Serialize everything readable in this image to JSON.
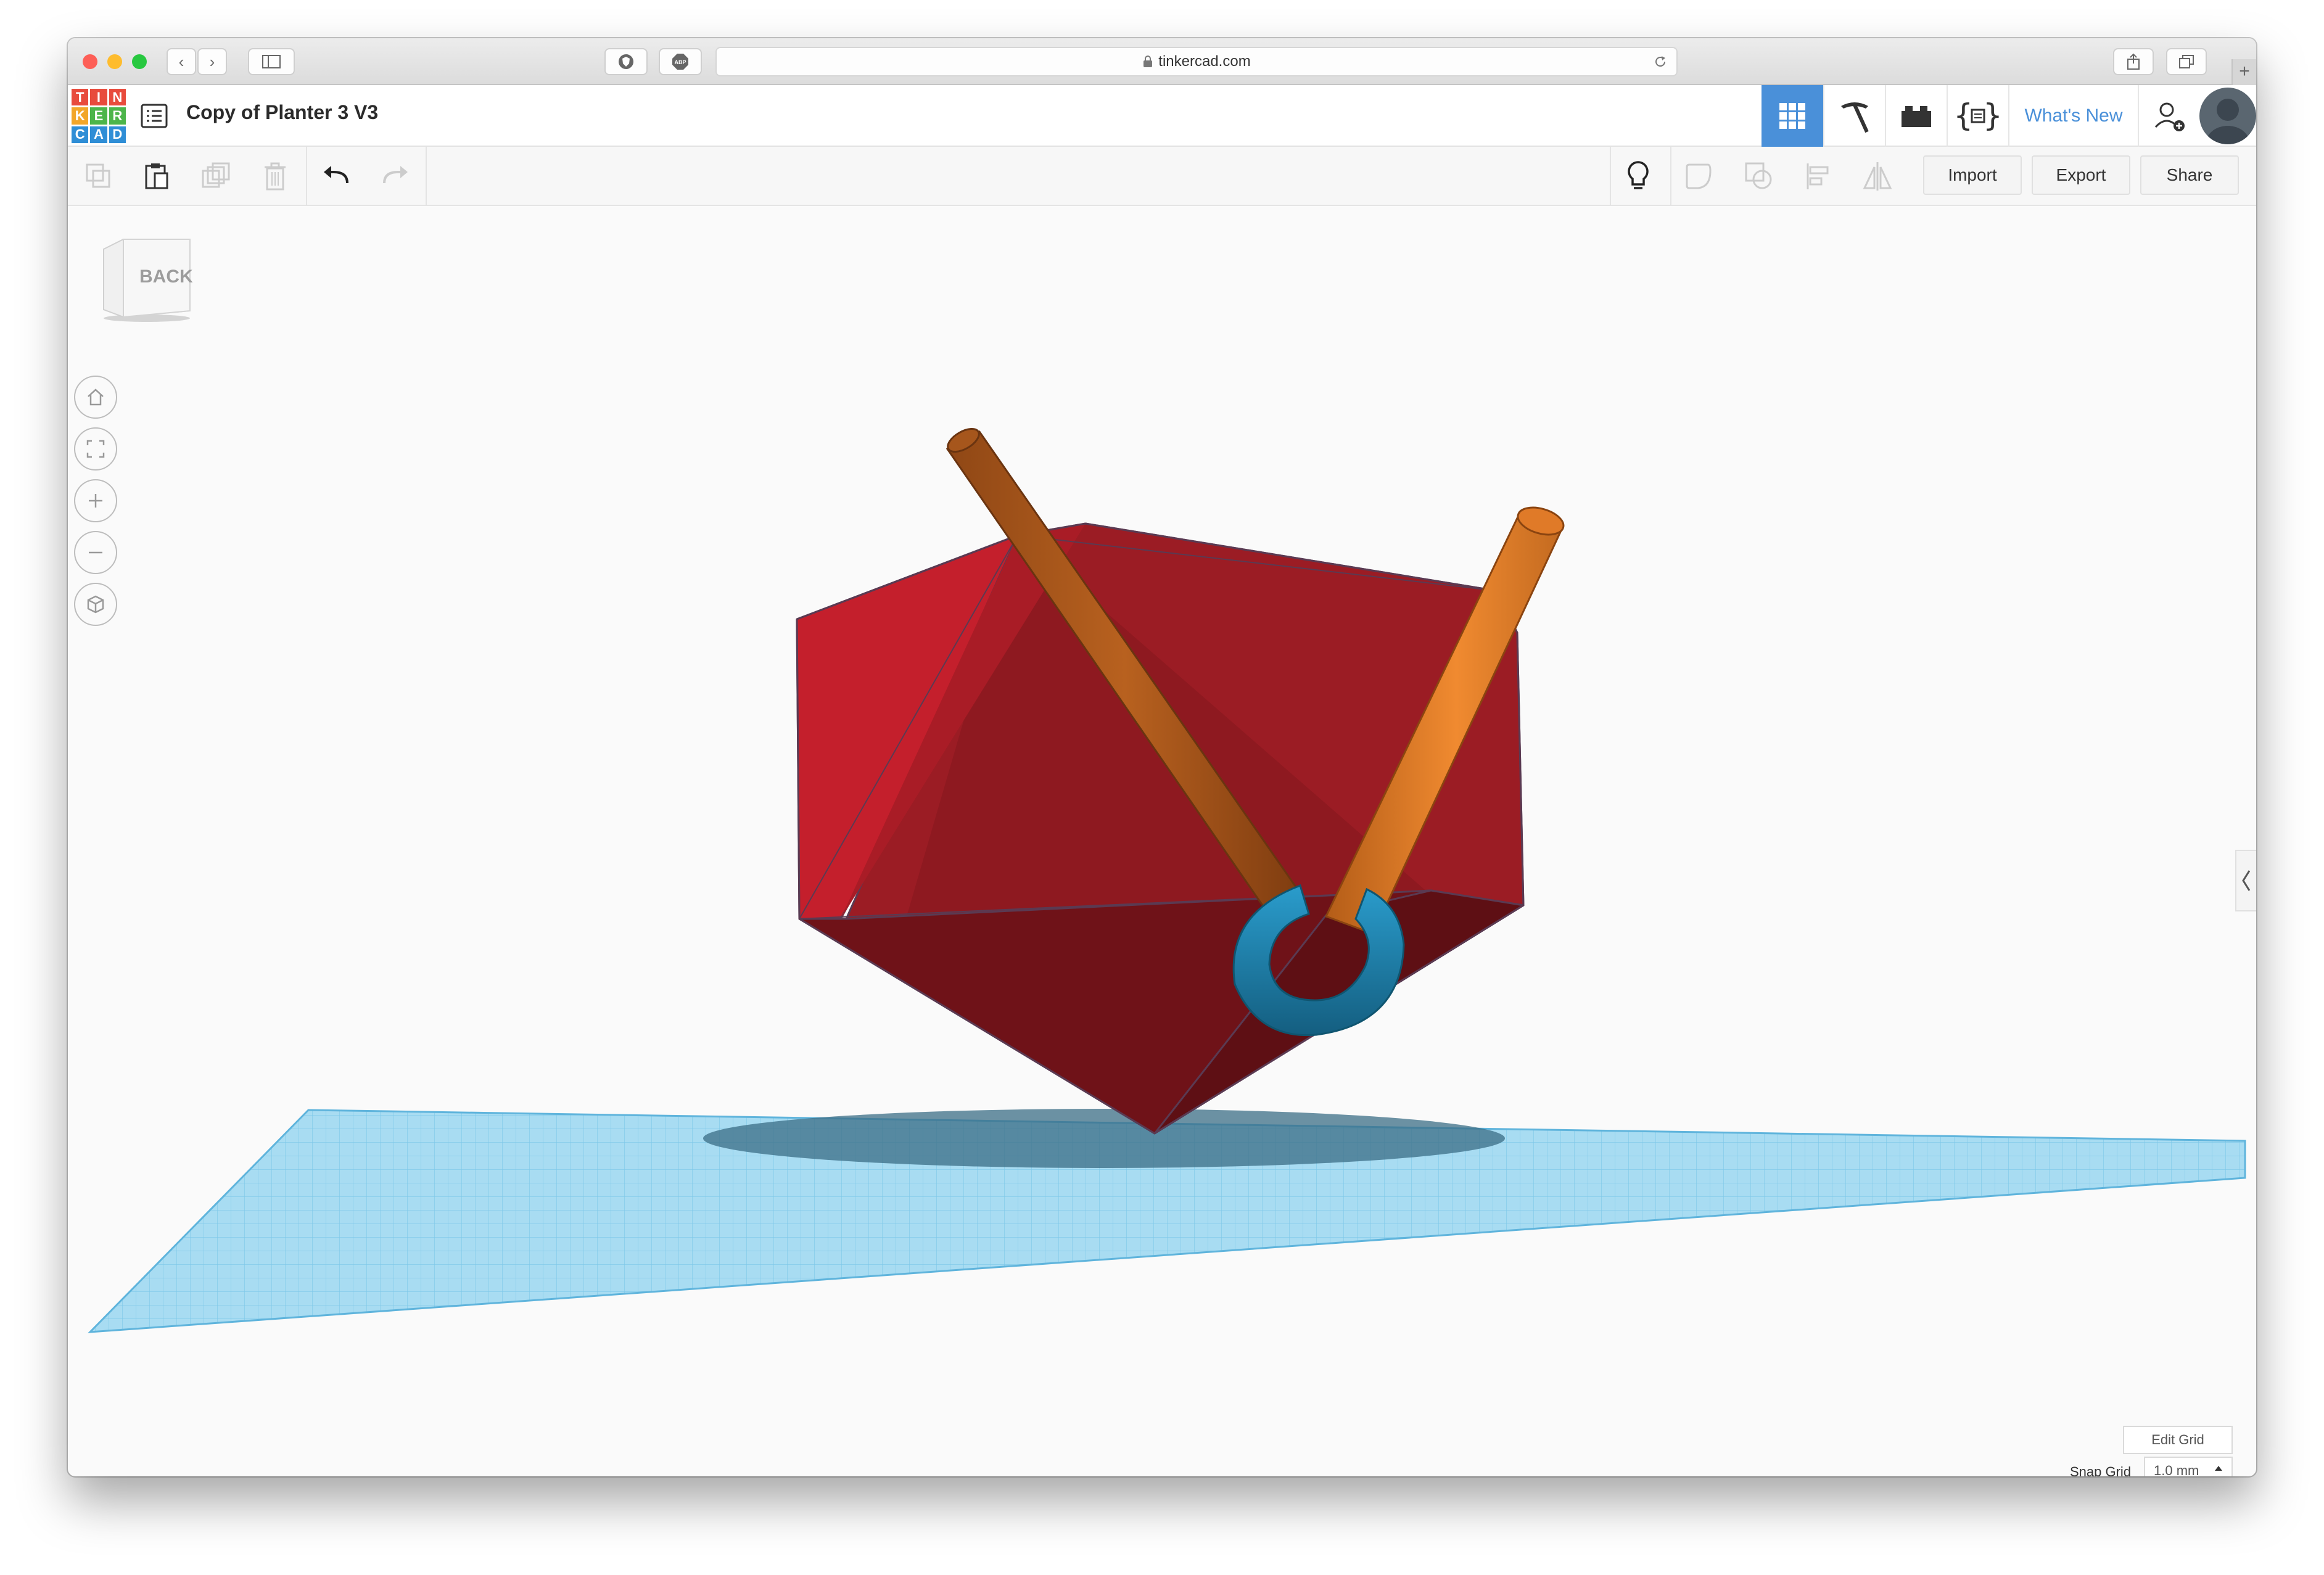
{
  "browser": {
    "url": "tinkercad.com"
  },
  "logo": {
    "letters": [
      "T",
      "I",
      "N",
      "K",
      "E",
      "R",
      "C",
      "A",
      "D"
    ]
  },
  "header": {
    "title": "Copy of Planter 3 V3",
    "whats_new": "What's New"
  },
  "toolbar": {
    "import_label": "Import",
    "export_label": "Export",
    "share_label": "Share"
  },
  "viewcube": {
    "face_label": "BACK"
  },
  "grid_controls": {
    "edit_grid_label": "Edit Grid",
    "snap_grid_label": "Snap Grid",
    "snap_grid_value": "1.0 mm"
  },
  "colors": {
    "accent": "#4a90d9",
    "body_red": "#9b1c24",
    "rod_orange": "#c0641e",
    "hook_blue": "#1d7fa8",
    "workplane_blue": "#8fd0ec"
  }
}
